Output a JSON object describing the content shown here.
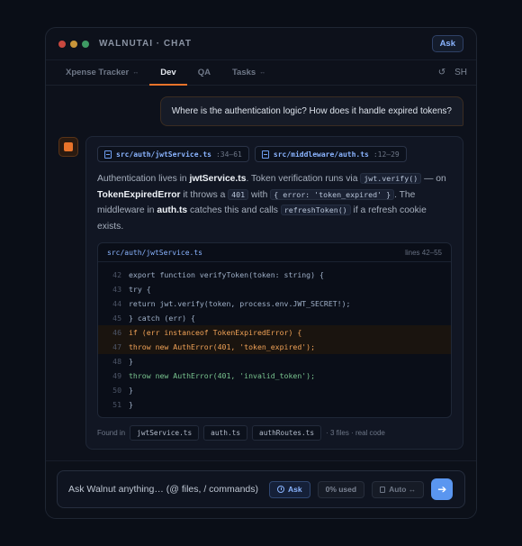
{
  "window": {
    "title": "WALNUTAI · CHAT",
    "ask_label": "Ask"
  },
  "tabs": [
    {
      "label": "Xpense Tracker",
      "caret": "↔"
    },
    {
      "label": "Dev"
    },
    {
      "label": "QA"
    },
    {
      "label": "Tasks",
      "caret": "↔"
    }
  ],
  "tab_actions": {
    "refresh": "↺",
    "user": "SH"
  },
  "user_message": "Where is the authentication logic? How does it handle expired tokens?",
  "answer": {
    "files": [
      {
        "path": "src/auth/jwtService.ts",
        "lines": ":34–61"
      },
      {
        "path": "src/middleware/auth.ts",
        "lines": ":12–29"
      }
    ],
    "text": {
      "p1": "Authentication lives in ",
      "b1": "jwtService.ts",
      "p2": ". Token verification runs via ",
      "c1": "jwt.verify()",
      "p3": " — on ",
      "b2": "TokenExpiredError",
      "p4": " it throws a ",
      "c2": "401",
      "p5": " with ",
      "c3": "{ error: 'token_expired' }",
      "p6": ". The middleware in ",
      "b3": "auth.ts",
      "p7": " catches this and calls ",
      "c4": "refreshToken()",
      "p8": " if a refresh cookie exists."
    },
    "code": {
      "path": "src/auth/jwtService.ts",
      "range": "lines 42–55",
      "lines": [
        {
          "n": "42",
          "text": "export function verifyToken(token: string) {"
        },
        {
          "n": "43",
          "text": "try {"
        },
        {
          "n": "44",
          "text": "return jwt.verify(token, process.env.JWT_SECRET!);"
        },
        {
          "n": "45",
          "text": "} catch (err) {"
        },
        {
          "n": "46",
          "text": "if (err instanceof TokenExpiredError) {"
        },
        {
          "n": "47",
          "text": "throw new AuthError(401, 'token_expired');"
        },
        {
          "n": "48",
          "text": "}"
        },
        {
          "n": "49",
          "text": "throw new AuthError(401, 'invalid_token');"
        },
        {
          "n": "50",
          "text": "}"
        },
        {
          "n": "51",
          "text": "}"
        }
      ]
    },
    "found": {
      "label": "Found in",
      "files": [
        "jwtService.ts",
        "auth.ts",
        "authRoutes.ts"
      ],
      "summary": "· 3 files · real code"
    }
  },
  "composer": {
    "placeholder": "Ask Walnut anything… (@ files, / commands)",
    "ask_label": "Ask",
    "usage": "0% used",
    "model": "Auto ↔",
    "send": "➔"
  },
  "colors": {
    "accent": "#e8732a",
    "link": "#8ab4ff",
    "send": "#5a96f0"
  }
}
